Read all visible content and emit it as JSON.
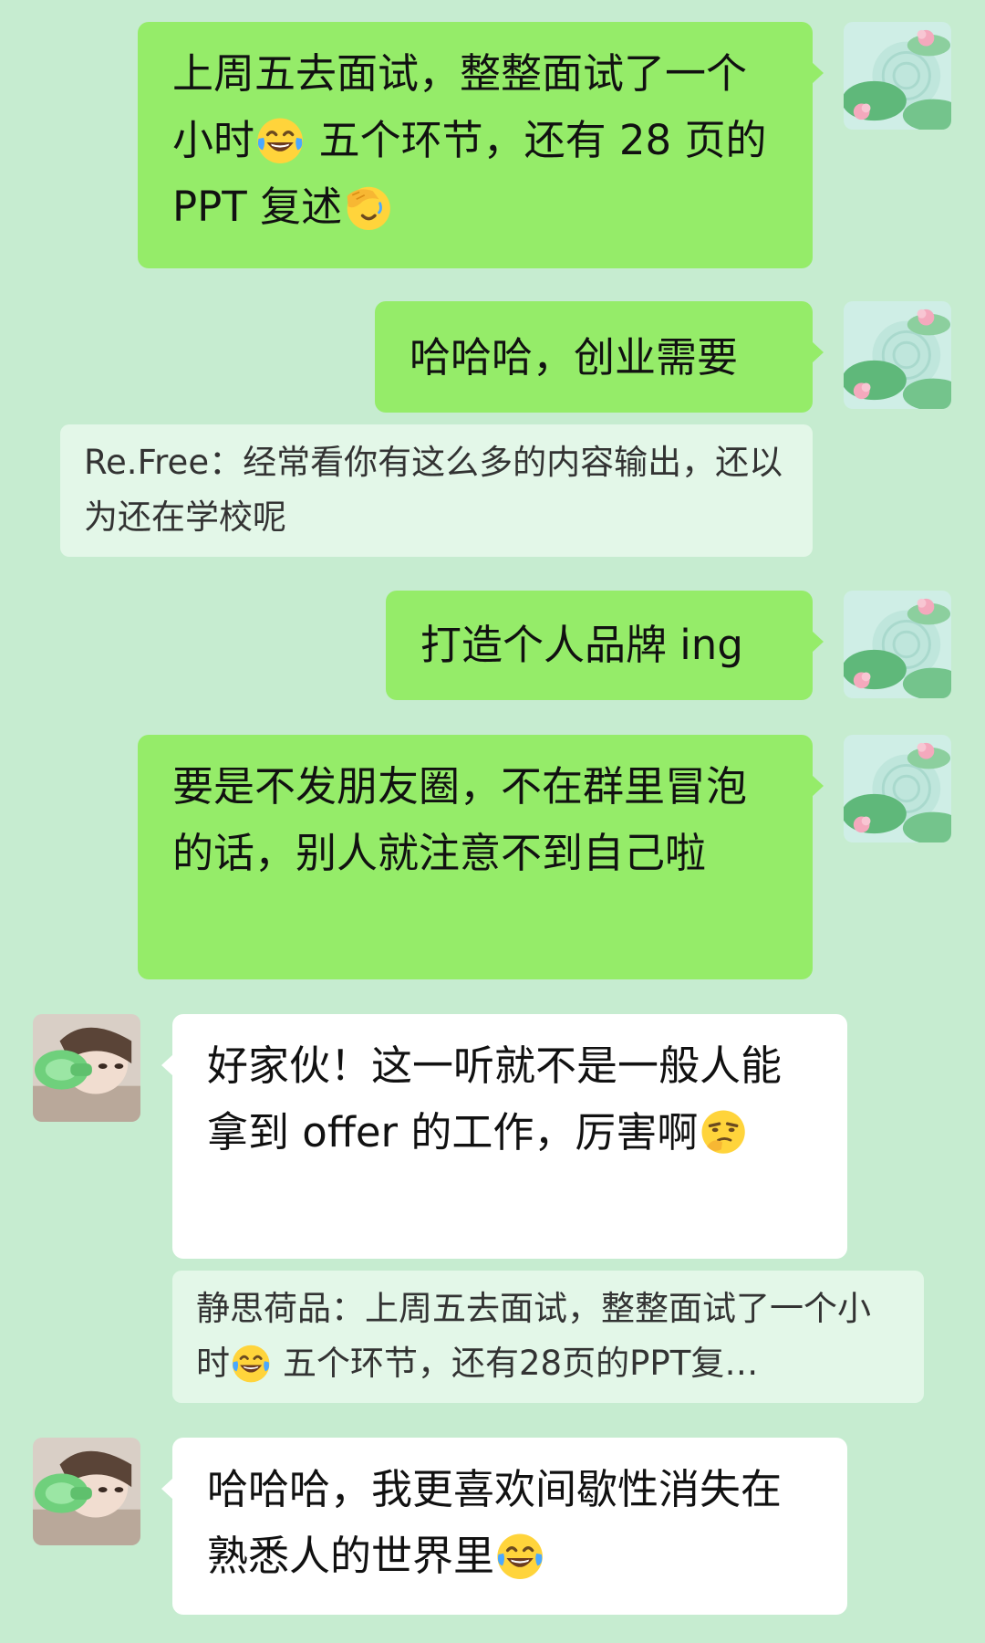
{
  "messages": [
    {
      "sender": "me",
      "text_a": "上周五去面试，整整面试了一个小时",
      "emoji_a": "tears-of-joy",
      "text_b": " 五个环节，还有 28 页的 PPT 复述",
      "emoji_b": "facepalm"
    },
    {
      "sender": "me",
      "text": "哈哈哈，创业需要"
    },
    {
      "type": "quote",
      "text": "Re.Free：经常看你有这么多的内容输出，还以为还在学校呢"
    },
    {
      "sender": "me",
      "text": "打造个人品牌 ing"
    },
    {
      "sender": "me",
      "text": "要是不发朋友圈，不在群里冒泡的话，别人就注意不到自己啦"
    },
    {
      "sender": "them",
      "text": "好家伙！这一听就不是一般人能拿到 offer 的工作，厉害啊",
      "emoji": "thinking-smirk"
    },
    {
      "type": "quote",
      "text_a": "静思荷品：上周五去面试，整整面试了一个小时",
      "emoji_a": "tears-of-joy",
      "text_b": " 五个环节，还有28页的PPT复…"
    },
    {
      "sender": "them",
      "text": "哈哈哈，我更喜欢间歇性消失在熟悉人的世界里",
      "emoji": "tears-of-joy"
    }
  ],
  "avatars": {
    "me": "lotus-pond-avatar",
    "them": "girl-drinking-avatar"
  },
  "colors": {
    "background": "#c6ecd0",
    "my_bubble": "#95ec69",
    "their_bubble": "#ffffff",
    "quote_box": "#e3f7e8"
  }
}
